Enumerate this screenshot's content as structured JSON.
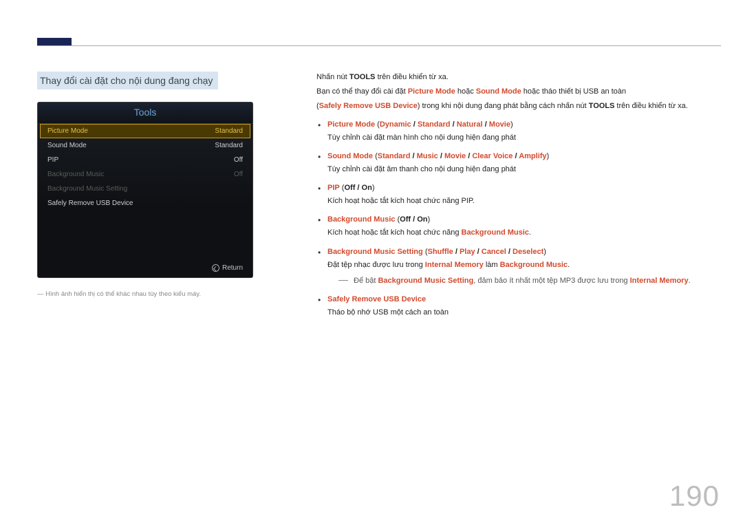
{
  "pageNumber": "190",
  "heading": "Thay đổi cài đặt cho nội dung đang chạy",
  "tools": {
    "title": "Tools",
    "rows": [
      {
        "label": "Picture Mode",
        "value": "Standard",
        "state": "selected"
      },
      {
        "label": "Sound Mode",
        "value": "Standard",
        "state": "normal"
      },
      {
        "label": "PIP",
        "value": "Off",
        "state": "normal"
      },
      {
        "label": "Background Music",
        "value": "Off",
        "state": "dim"
      },
      {
        "label": "Background Music Setting",
        "value": "",
        "state": "dim"
      },
      {
        "label": "Safely Remove USB Device",
        "value": "",
        "state": "normal"
      }
    ],
    "returnLabel": "Return"
  },
  "leftNote": "―  Hình ảnh hiển thị có thể khác nhau tùy theo kiểu máy.",
  "intro": {
    "line1_pre": "Nhấn nút ",
    "line1_bold": "TOOLS",
    "line1_post": " trên điều khiển từ xa.",
    "line2_pre": "Bạn có thể thay đổi cài đặt ",
    "pm": "Picture Mode",
    "line2_mid": " hoặc ",
    "sm": "Sound Mode",
    "line2_post": " hoặc tháo thiết bị USB an toàn",
    "line3_open": "(",
    "srud": "Safely Remove USB Device",
    "line3_mid": ") trong khi nội dung đang phát bằng cách nhấn nút ",
    "line3_bold": "TOOLS",
    "line3_post": " trên điều khiển từ xa."
  },
  "items": {
    "pictureMode": {
      "label": "Picture Mode",
      "opts": [
        "Dynamic",
        "Standard",
        "Natural",
        "Movie"
      ],
      "desc": "Tùy chỉnh cài đặt màn hình cho nội dung hiện đang phát"
    },
    "soundMode": {
      "label": "Sound Mode",
      "opts": [
        "Standard",
        "Music",
        "Movie",
        "Clear Voice",
        "Amplify"
      ],
      "desc": "Tùy chỉnh cài đặt âm thanh cho nội dung hiện đang phát"
    },
    "pip": {
      "label": "PIP",
      "opts": [
        "Off",
        "On"
      ],
      "desc": "Kích hoạt hoặc tắt kích hoạt chức năng PIP."
    },
    "bgm": {
      "label": "Background Music",
      "opts": [
        "Off",
        "On"
      ],
      "desc_pre": "Kích hoạt hoặc tắt kích hoạt chức năng ",
      "desc_red": "Background Music",
      "desc_post": "."
    },
    "bgms": {
      "label": "Background Music Setting",
      "opts": [
        "Shuffle",
        "Play",
        "Cancel",
        "Deselect"
      ],
      "desc_pre": "Đặt tệp nhạc được lưu trong ",
      "desc_red1": "Internal Memory",
      "desc_mid": " làm ",
      "desc_red2": "Background Music",
      "desc_post": "."
    },
    "note": {
      "pre": "Để bật ",
      "r1": "Background Music Setting",
      "mid": ", đảm bảo ít nhất một tệp MP3 được lưu trong ",
      "r2": "Internal Memory",
      "post": "."
    },
    "srud": {
      "label": "Safely Remove USB Device",
      "desc": "Tháo bộ nhớ USB một cách an toàn"
    }
  }
}
